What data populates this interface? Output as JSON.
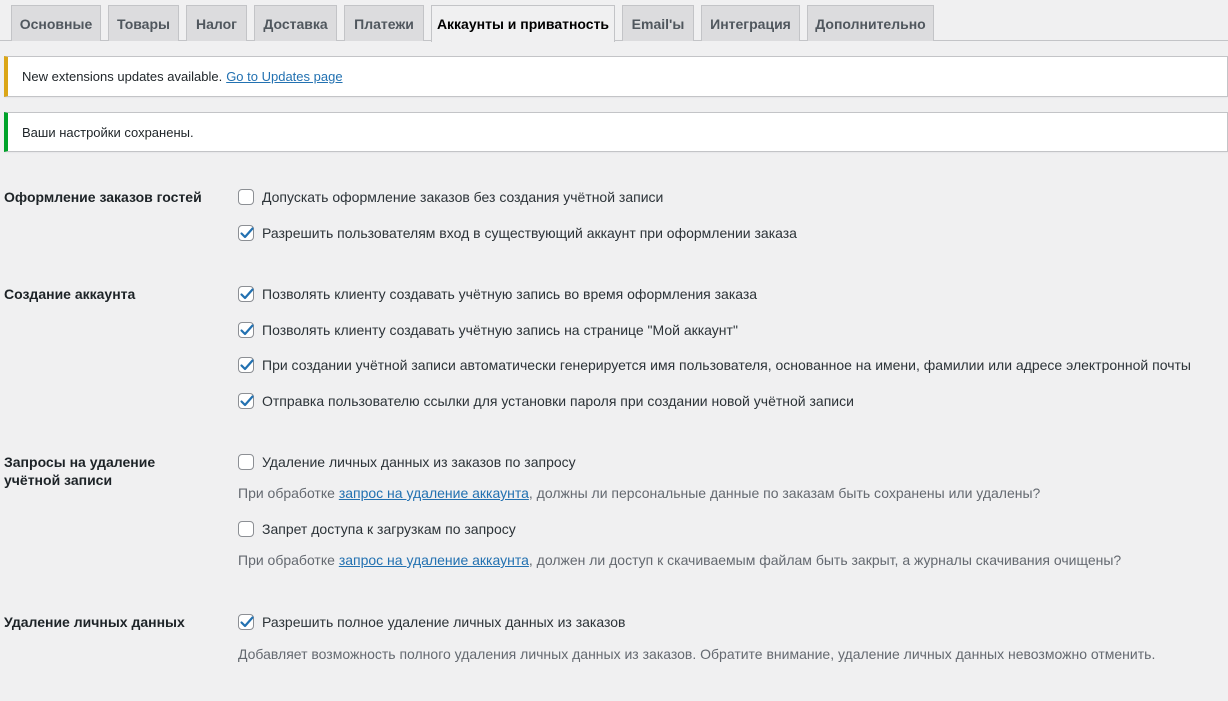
{
  "tabs": [
    {
      "label": "Основные",
      "active": false
    },
    {
      "label": "Товары",
      "active": false
    },
    {
      "label": "Налог",
      "active": false
    },
    {
      "label": "Доставка",
      "active": false
    },
    {
      "label": "Платежи",
      "active": false
    },
    {
      "label": "Аккаунты и приватность",
      "active": true
    },
    {
      "label": "Email'ы",
      "active": false
    },
    {
      "label": "Интеграция",
      "active": false
    },
    {
      "label": "Дополнительно",
      "active": false
    }
  ],
  "notices": {
    "updates": {
      "text": "New extensions updates available.",
      "link": "Go to Updates page",
      "color": "#dba617"
    },
    "saved": {
      "text": "Ваши настройки сохранены.",
      "color": "#00a32a"
    }
  },
  "sections": {
    "guest_checkout": {
      "label": "Оформление заказов гостей",
      "options": [
        {
          "label": "Допускать оформление заказов без создания учётной записи",
          "checked": false
        },
        {
          "label": "Разрешить пользователям вход в существующий аккаунт при оформлении заказа",
          "checked": true
        }
      ]
    },
    "account_creation": {
      "label": "Создание аккаунта",
      "options": [
        {
          "label": "Позволять клиенту создавать учётную запись во время оформления заказа",
          "checked": true
        },
        {
          "label": "Позволять клиенту создавать учётную запись на странице \"Мой аккаунт\"",
          "checked": true
        },
        {
          "label": "При создании учётной записи автоматически генерируется имя пользователя, основанное на имени, фамилии или адресе электронной почты",
          "checked": true
        },
        {
          "label": "Отправка пользователю ссылки для установки пароля при создании новой учётной записи",
          "checked": true
        }
      ]
    },
    "erasure_requests": {
      "label": "Запросы на удаление учётной записи",
      "options": [
        {
          "label": "Удаление личных данных из заказов по запросу",
          "checked": false,
          "desc_before": "При обработке ",
          "desc_link": "запрос на удаление аккаунта",
          "desc_after": ", должны ли персональные данные по заказам быть сохранены или удалены?"
        },
        {
          "label": "Запрет доступа к загрузкам по запросу",
          "checked": false,
          "desc_before": "При обработке ",
          "desc_link": "запрос на удаление аккаунта",
          "desc_after": ", должен ли доступ к скачиваемым файлам быть закрыт, а журналы скачивания очищены?"
        }
      ]
    },
    "personal_data_removal": {
      "label": "Удаление личных данных",
      "options": [
        {
          "label": "Разрешить полное удаление личных данных из заказов",
          "checked": true
        }
      ],
      "desc": "Добавляет возможность полного удаления личных данных из заказов. Обратите внимание, удаление личных данных невозможно отменить."
    }
  }
}
